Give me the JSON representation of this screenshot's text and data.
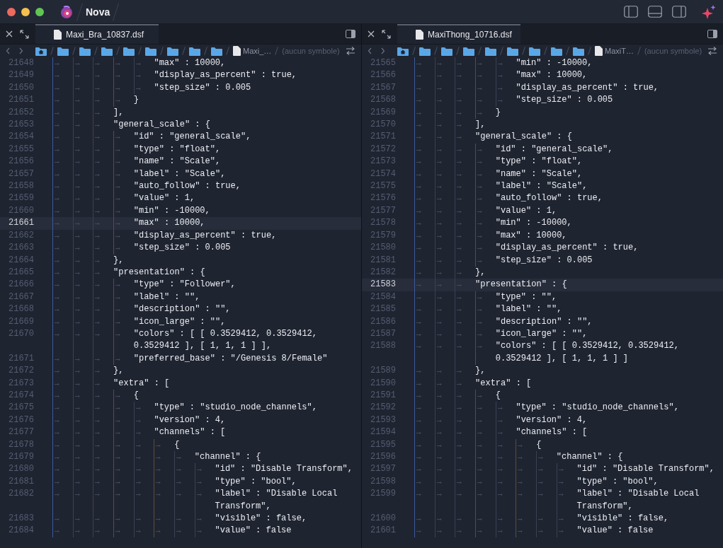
{
  "window": {
    "title": "Nova"
  },
  "panes": [
    {
      "file": "Maxi_Bra_10837.dsf",
      "path": [
        {
          "kind": "home"
        },
        {
          "kind": "folder"
        },
        {
          "kind": "folder"
        },
        {
          "kind": "folder"
        },
        {
          "kind": "folder"
        },
        {
          "kind": "folder"
        },
        {
          "kind": "folder"
        },
        {
          "kind": "folder"
        },
        {
          "kind": "folder"
        }
      ],
      "crumb_file": "Maxi_…",
      "symbol": "(aucun symbole)",
      "lines": [
        {
          "number": "21648",
          "text": "\t\t\t\t\t\t\"max\" : 10000,",
          "current": false
        },
        {
          "number": "21649",
          "text": "\t\t\t\t\t\t\"display_as_percent\" : true,",
          "current": false
        },
        {
          "number": "21650",
          "text": "\t\t\t\t\t\t\"step_size\" : 0.005",
          "current": false
        },
        {
          "number": "21651",
          "text": "\t\t\t\t\t}",
          "current": false
        },
        {
          "number": "21652",
          "text": "\t\t\t\t],",
          "current": false
        },
        {
          "number": "21653",
          "text": "\t\t\t\t\"general_scale\" : {",
          "current": false
        },
        {
          "number": "21654",
          "text": "\t\t\t\t\t\"id\" : \"general_scale\",",
          "current": false
        },
        {
          "number": "21655",
          "text": "\t\t\t\t\t\"type\" : \"float\",",
          "current": false
        },
        {
          "number": "21656",
          "text": "\t\t\t\t\t\"name\" : \"Scale\",",
          "current": false
        },
        {
          "number": "21657",
          "text": "\t\t\t\t\t\"label\" : \"Scale\",",
          "current": false
        },
        {
          "number": "21658",
          "text": "\t\t\t\t\t\"auto_follow\" : true,",
          "current": false
        },
        {
          "number": "21659",
          "text": "\t\t\t\t\t\"value\" : 1,",
          "current": false
        },
        {
          "number": "21660",
          "text": "\t\t\t\t\t\"min\" : -10000,",
          "current": false
        },
        {
          "number": "21661",
          "text": "\t\t\t\t\t\"max\" : 10000,",
          "current": true
        },
        {
          "number": "21662",
          "text": "\t\t\t\t\t\"display_as_percent\" : true,",
          "current": false
        },
        {
          "number": "21663",
          "text": "\t\t\t\t\t\"step_size\" : 0.005",
          "current": false
        },
        {
          "number": "21664",
          "text": "\t\t\t\t},",
          "current": false
        },
        {
          "number": "21665",
          "text": "\t\t\t\t\"presentation\" : {",
          "current": false
        },
        {
          "number": "21666",
          "text": "\t\t\t\t\t\"type\" : \"Follower\",",
          "current": false
        },
        {
          "number": "21667",
          "text": "\t\t\t\t\t\"label\" : \"\",",
          "current": false
        },
        {
          "number": "21668",
          "text": "\t\t\t\t\t\"description\" : \"\",",
          "current": false
        },
        {
          "number": "21669",
          "text": "\t\t\t\t\t\"icon_large\" : \"\",",
          "current": false
        },
        {
          "number": "21670",
          "text": "\t\t\t\t\t\"colors\" : [ [ 0.3529412, 0.3529412,",
          "continuation": "0.3529412 ], [ 1, 1, 1 ] ],",
          "current": false
        },
        {
          "number": "21671",
          "text": "\t\t\t\t\t\"preferred_base\" : \"/Genesis 8/Female\"",
          "current": false
        },
        {
          "number": "21672",
          "text": "\t\t\t\t},",
          "current": false
        },
        {
          "number": "21673",
          "text": "\t\t\t\t\"extra\" : [",
          "current": false
        },
        {
          "number": "21674",
          "text": "\t\t\t\t\t{",
          "current": false
        },
        {
          "number": "21675",
          "text": "\t\t\t\t\t\t\"type\" : \"studio_node_channels\",",
          "current": false
        },
        {
          "number": "21676",
          "text": "\t\t\t\t\t\t\"version\" : 4,",
          "current": false
        },
        {
          "number": "21677",
          "text": "\t\t\t\t\t\t\"channels\" : [",
          "current": false
        },
        {
          "number": "21678",
          "text": "\t\t\t\t\t\t\t{",
          "current": false
        },
        {
          "number": "21679",
          "text": "\t\t\t\t\t\t\t\t\"channel\" : {",
          "current": false
        },
        {
          "number": "21680",
          "text": "\t\t\t\t\t\t\t\t\t\"id\" : \"Disable Transform\",",
          "current": false
        },
        {
          "number": "21681",
          "text": "\t\t\t\t\t\t\t\t\t\"type\" : \"bool\",",
          "current": false
        },
        {
          "number": "21682",
          "text": "\t\t\t\t\t\t\t\t\t\"label\" : \"Disable Local",
          "continuation": "Transform\",",
          "current": false
        },
        {
          "number": "21683",
          "text": "\t\t\t\t\t\t\t\t\t\"visible\" : false,",
          "current": false
        },
        {
          "number": "21684",
          "text": "\t\t\t\t\t\t\t\t\t\"value\" : false",
          "current": false
        }
      ]
    },
    {
      "file": "MaxiThong_10716.dsf",
      "path": [
        {
          "kind": "home"
        },
        {
          "kind": "folder"
        },
        {
          "kind": "folder"
        },
        {
          "kind": "folder"
        },
        {
          "kind": "folder"
        },
        {
          "kind": "folder"
        },
        {
          "kind": "folder"
        },
        {
          "kind": "folder"
        },
        {
          "kind": "folder"
        }
      ],
      "crumb_file": "MaxiT…",
      "symbol": "(aucun symbole)",
      "lines": [
        {
          "number": "21565",
          "text": "\t\t\t\t\t\t\"min\" : -10000,",
          "current": false
        },
        {
          "number": "21566",
          "text": "\t\t\t\t\t\t\"max\" : 10000,",
          "current": false
        },
        {
          "number": "21567",
          "text": "\t\t\t\t\t\t\"display_as_percent\" : true,",
          "current": false
        },
        {
          "number": "21568",
          "text": "\t\t\t\t\t\t\"step_size\" : 0.005",
          "current": false
        },
        {
          "number": "21569",
          "text": "\t\t\t\t\t}",
          "current": false
        },
        {
          "number": "21570",
          "text": "\t\t\t\t],",
          "current": false
        },
        {
          "number": "21571",
          "text": "\t\t\t\t\"general_scale\" : {",
          "current": false
        },
        {
          "number": "21572",
          "text": "\t\t\t\t\t\"id\" : \"general_scale\",",
          "current": false
        },
        {
          "number": "21573",
          "text": "\t\t\t\t\t\"type\" : \"float\",",
          "current": false
        },
        {
          "number": "21574",
          "text": "\t\t\t\t\t\"name\" : \"Scale\",",
          "current": false
        },
        {
          "number": "21575",
          "text": "\t\t\t\t\t\"label\" : \"Scale\",",
          "current": false
        },
        {
          "number": "21576",
          "text": "\t\t\t\t\t\"auto_follow\" : true,",
          "current": false
        },
        {
          "number": "21577",
          "text": "\t\t\t\t\t\"value\" : 1,",
          "current": false
        },
        {
          "number": "21578",
          "text": "\t\t\t\t\t\"min\" : -10000,",
          "current": false
        },
        {
          "number": "21579",
          "text": "\t\t\t\t\t\"max\" : 10000,",
          "current": false
        },
        {
          "number": "21580",
          "text": "\t\t\t\t\t\"display_as_percent\" : true,",
          "current": false
        },
        {
          "number": "21581",
          "text": "\t\t\t\t\t\"step_size\" : 0.005",
          "current": false
        },
        {
          "number": "21582",
          "text": "\t\t\t\t},",
          "current": false
        },
        {
          "number": "21583",
          "text": "\t\t\t\t\"presentation\" : {",
          "current": true
        },
        {
          "number": "21584",
          "text": "\t\t\t\t\t\"type\" : \"\",",
          "current": false
        },
        {
          "number": "21585",
          "text": "\t\t\t\t\t\"label\" : \"\",",
          "current": false
        },
        {
          "number": "21586",
          "text": "\t\t\t\t\t\"description\" : \"\",",
          "current": false
        },
        {
          "number": "21587",
          "text": "\t\t\t\t\t\"icon_large\" : \"\",",
          "current": false
        },
        {
          "number": "21588",
          "text": "\t\t\t\t\t\"colors\" : [ [ 0.3529412, 0.3529412,",
          "continuation": "0.3529412 ], [ 1, 1, 1 ] ]",
          "current": false
        },
        {
          "number": "21589",
          "text": "\t\t\t\t},",
          "current": false
        },
        {
          "number": "21590",
          "text": "\t\t\t\t\"extra\" : [",
          "current": false
        },
        {
          "number": "21591",
          "text": "\t\t\t\t\t{",
          "current": false
        },
        {
          "number": "21592",
          "text": "\t\t\t\t\t\t\"type\" : \"studio_node_channels\",",
          "current": false
        },
        {
          "number": "21593",
          "text": "\t\t\t\t\t\t\"version\" : 4,",
          "current": false
        },
        {
          "number": "21594",
          "text": "\t\t\t\t\t\t\"channels\" : [",
          "current": false
        },
        {
          "number": "21595",
          "text": "\t\t\t\t\t\t\t{",
          "current": false
        },
        {
          "number": "21596",
          "text": "\t\t\t\t\t\t\t\t\"channel\" : {",
          "current": false
        },
        {
          "number": "21597",
          "text": "\t\t\t\t\t\t\t\t\t\"id\" : \"Disable Transform\",",
          "current": false
        },
        {
          "number": "21598",
          "text": "\t\t\t\t\t\t\t\t\t\"type\" : \"bool\",",
          "current": false
        },
        {
          "number": "21599",
          "text": "\t\t\t\t\t\t\t\t\t\"label\" : \"Disable Local",
          "continuation": "Transform\",",
          "current": false
        },
        {
          "number": "21600",
          "text": "\t\t\t\t\t\t\t\t\t\"visible\" : false,",
          "current": false
        },
        {
          "number": "21601",
          "text": "\t\t\t\t\t\t\t\t\t\"value\" : false",
          "current": false
        }
      ]
    }
  ]
}
